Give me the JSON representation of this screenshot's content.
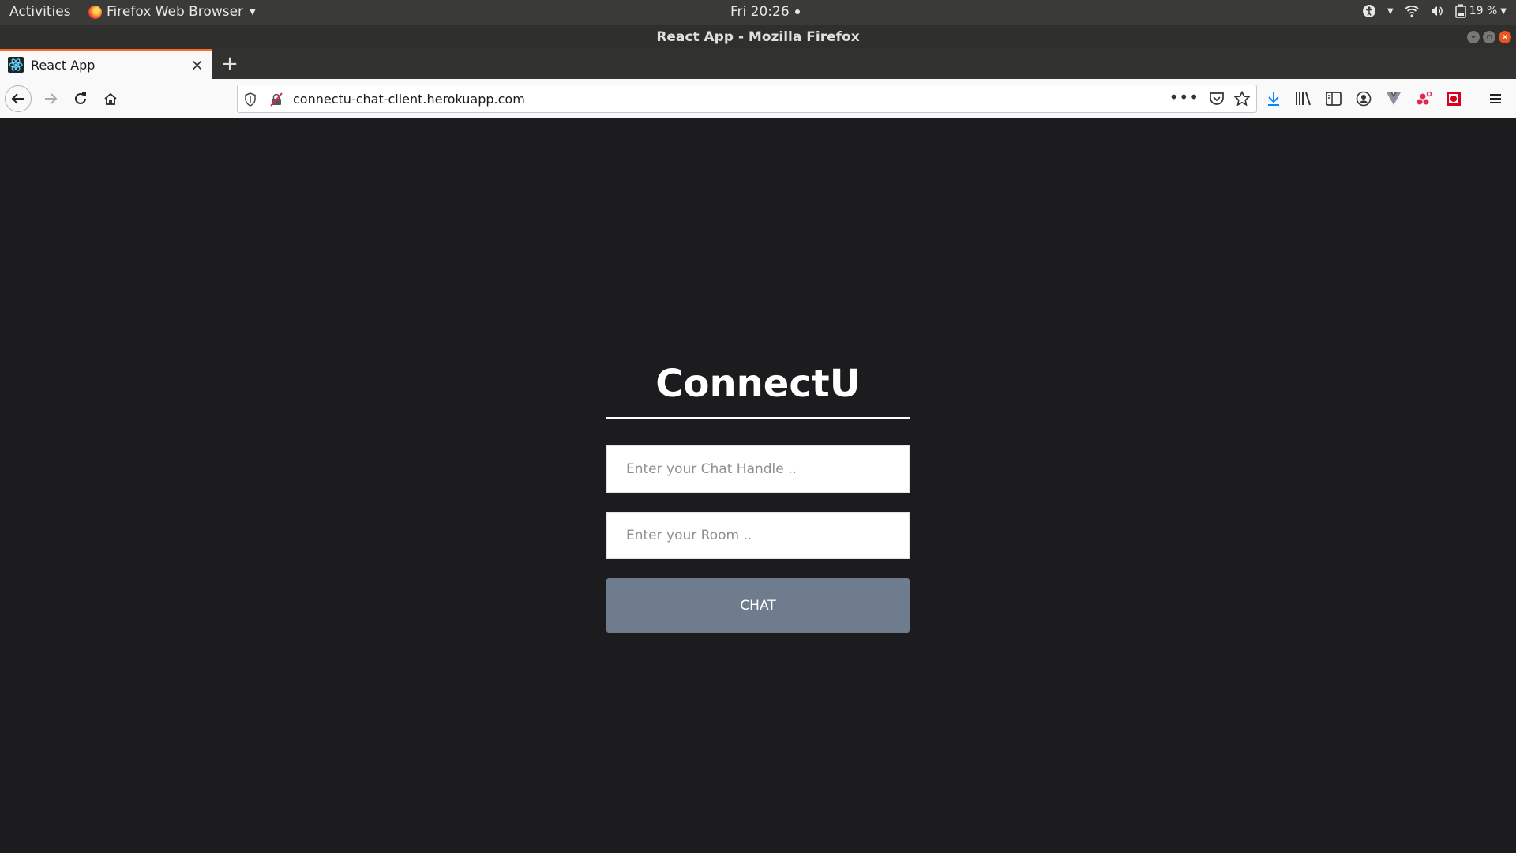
{
  "system_bar": {
    "activities": "Activities",
    "app_name": "Firefox Web Browser",
    "clock": "Fri 20:26",
    "battery": "19 %"
  },
  "window": {
    "title": "React App - Mozilla Firefox"
  },
  "tabs": [
    {
      "label": "React App",
      "active": true
    }
  ],
  "navigation": {
    "url": "connectu-chat-client.herokuapp.com"
  },
  "join_form": {
    "heading": "ConnectU",
    "name_placeholder": "Enter your Chat Handle ..",
    "room_placeholder": "Enter your Room ..",
    "button_label": "CHAT"
  },
  "colors": {
    "page_background": "#1c1b1e",
    "button_background": "#6f7c8e",
    "tab_accent": "#ff6a2b"
  },
  "icons": [
    "firefox-icon",
    "accessibility-icon",
    "wifi-icon",
    "volume-icon",
    "battery-icon",
    "react-icon",
    "tracking-shield-icon",
    "insecure-lock-icon",
    "pocket-icon",
    "bookmark-star-icon",
    "download-icon",
    "library-icon",
    "sidebar-icon",
    "account-icon",
    "extension-icon",
    "menu-icon"
  ]
}
